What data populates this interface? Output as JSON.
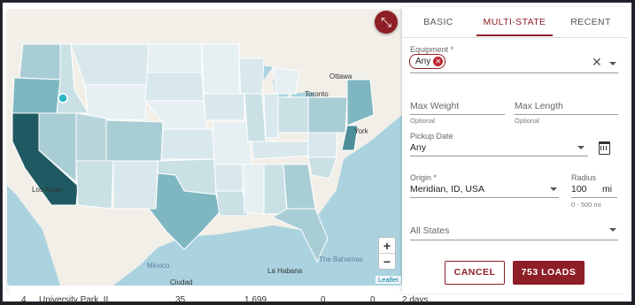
{
  "map": {
    "collapse_icon": "collapse-arrows-icon",
    "zoom_in": "+",
    "zoom_out": "−",
    "attribution": "Leaflet",
    "labels": {
      "ottawa": "Ottawa",
      "toronto": "Toronto",
      "new_york": "York",
      "los_angeles": "Los Ange",
      "mexico": "México",
      "la_habana": "La Habana",
      "bahamas": "The Bahamas",
      "ciudad": "Ciudad"
    },
    "colors": {
      "water": "#aad3df",
      "land": "#f2efe9",
      "low": "#e6eff2",
      "mid": "#a9cdd4",
      "high": "#7fb7c1",
      "max": "#1f5a63",
      "marker": "#2bb5c6"
    }
  },
  "panel": {
    "tabs": [
      "BASIC",
      "MULTI-STATE",
      "RECENT"
    ],
    "active_tab": "MULTI-STATE",
    "equipment": {
      "label": "Equipment *",
      "chip": "Any"
    },
    "max_weight": {
      "placeholder": "Max Weight",
      "help": "Optional"
    },
    "max_length": {
      "placeholder": "Max Length",
      "help": "Optional"
    },
    "pickup_date": {
      "label": "Pickup Date",
      "value": "Any"
    },
    "origin": {
      "label": "Origin *",
      "value": "Meridian, ID, USA"
    },
    "radius": {
      "label": "Radius",
      "value": "100",
      "unit": "mi",
      "help": "0 - 500 mi"
    },
    "states": {
      "placeholder": "All States"
    },
    "cancel": "CANCEL",
    "submit": "753 LOADS"
  },
  "background_row": {
    "col1": "4",
    "col2": "University Park, IL",
    "col3": "35",
    "col4": "1,699",
    "col5": "0",
    "col6": "0",
    "col7": "2 days"
  }
}
